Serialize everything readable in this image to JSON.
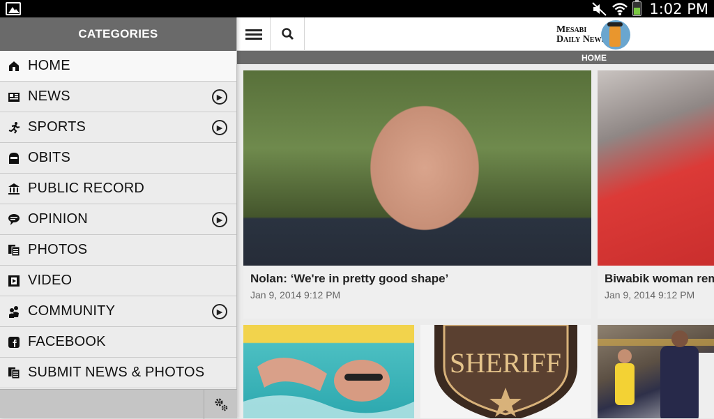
{
  "status_bar": {
    "time": "1:02 PM"
  },
  "drawer": {
    "header": "CATEGORIES",
    "items": [
      {
        "label": "HOME",
        "icon": "home-icon",
        "has_submenu": false,
        "active": true
      },
      {
        "label": "NEWS",
        "icon": "newspaper-icon",
        "has_submenu": true
      },
      {
        "label": "SPORTS",
        "icon": "runner-icon",
        "has_submenu": true
      },
      {
        "label": "OBITS",
        "icon": "tombstone-icon",
        "has_submenu": false
      },
      {
        "label": "PUBLIC RECORD",
        "icon": "bank-icon",
        "has_submenu": false
      },
      {
        "label": "OPINION",
        "icon": "speech-bubble-icon",
        "has_submenu": true
      },
      {
        "label": "PHOTOS",
        "icon": "documents-icon",
        "has_submenu": false
      },
      {
        "label": "VIDEO",
        "icon": "film-icon",
        "has_submenu": false
      },
      {
        "label": "COMMUNITY",
        "icon": "people-icon",
        "has_submenu": true
      },
      {
        "label": "FACEBOOK",
        "icon": "facebook-icon",
        "has_submenu": false
      },
      {
        "label": "SUBMIT NEWS & PHOTOS",
        "icon": "documents-icon",
        "has_submenu": false
      }
    ]
  },
  "header": {
    "logo_line1": "Mesabi",
    "logo_line2": "Daily News",
    "section": "HOME"
  },
  "articles": [
    {
      "title": "Nolan: ‘We're in pretty good shape’",
      "date": "Jan 9, 2014 9:12 PM"
    },
    {
      "title": "Biwabik woman rem",
      "date": "Jan 9, 2014 9:12 PM"
    }
  ],
  "thumbnails": [
    {
      "image": "swimmer-photo"
    },
    {
      "image": "sheriff-badge-photo",
      "text": "SHERIFF"
    },
    {
      "image": "basketball-photo"
    }
  ],
  "colors": {
    "header_gray": "#6a6a6a",
    "drawer_bg": "#ececec"
  }
}
